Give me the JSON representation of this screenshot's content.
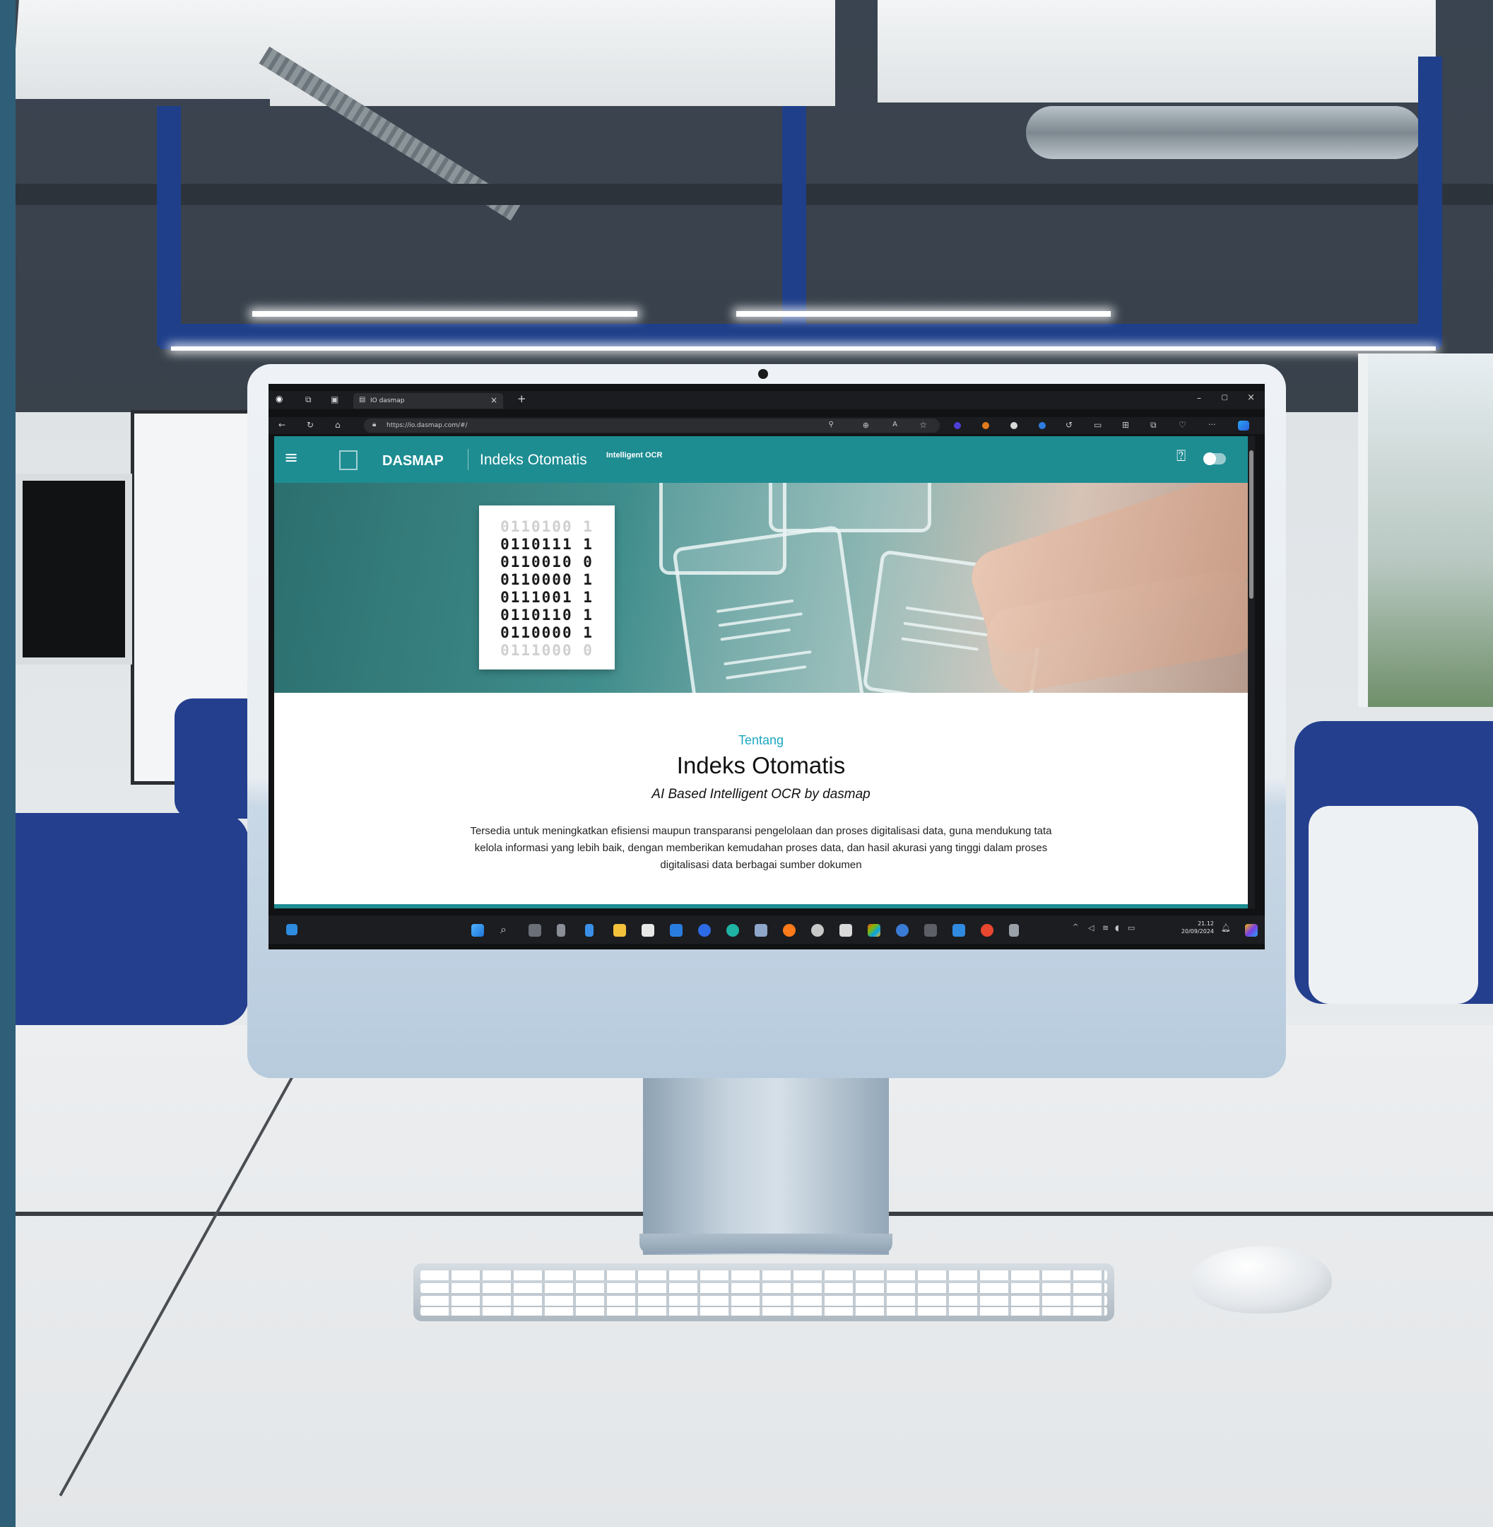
{
  "browser": {
    "tab_title": "IO dasmap",
    "tab_close": "×",
    "new_tab": "+",
    "url": "https://io.dasmap.com/#/",
    "window_controls": {
      "minimize": "–",
      "maximize": "▢",
      "close": "×"
    },
    "more_menu": "···"
  },
  "app": {
    "brand": "DASMAP",
    "title": "Indeks Otomatis",
    "badge": "Intelligent OCR",
    "accent_color": "#1d8d92"
  },
  "hero": {
    "binary_rows": [
      "0110100 1",
      "0110111 1",
      "0110010 0",
      "0110000 1",
      "0111001 1",
      "0110110 1",
      "0110000 1",
      "0111000 0"
    ]
  },
  "about": {
    "eyebrow": "Tentang",
    "heading": "Indeks Otomatis",
    "subheading": "AI Based Intelligent OCR by dasmap",
    "description_lines": [
      "Tersedia untuk meningkatkan efisiensi maupun transparansi pengelolaan dan proses digitalisasi data, guna mendukung tata",
      "kelola informasi yang lebih baik, dengan memberikan kemudahan proses data, dan hasil akurasi yang tinggi dalam proses",
      "digitalisasi data berbagai sumber dokumen"
    ]
  },
  "taskbar": {
    "time": "21.12",
    "date": "20/09/2024"
  }
}
